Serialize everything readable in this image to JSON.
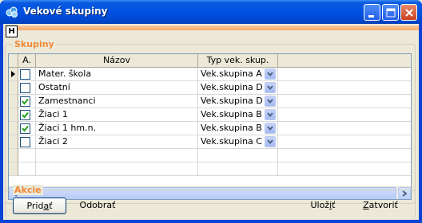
{
  "window": {
    "title": "Vekové skupiny",
    "menu_hotkey": "H"
  },
  "colors": {
    "titlebar": "#0052e2",
    "group_label": "#f08838",
    "face": "#ece9d8",
    "check": "#21a121"
  },
  "groups": {
    "skupiny": "Skupiny",
    "akcie": "Akcie"
  },
  "grid": {
    "headers": [
      "A.",
      "Názov",
      "Typ vek. skup."
    ],
    "rows": [
      {
        "active": false,
        "name": "Mater. škola",
        "type": "Vek.skupina A",
        "current": true
      },
      {
        "active": false,
        "name": "Ostatní",
        "type": "Vek.skupina D",
        "current": false
      },
      {
        "active": true,
        "name": "Zamestnanci",
        "type": "Vek.skupina D",
        "current": false
      },
      {
        "active": true,
        "name": "Žiaci 1",
        "type": "Vek.skupina B",
        "current": false
      },
      {
        "active": true,
        "name": "Žiaci 1 hm.n.",
        "type": "Vek.skupina B",
        "current": false
      },
      {
        "active": false,
        "name": "Žiaci 2",
        "type": "Vek.skupina C",
        "current": false
      }
    ]
  },
  "buttons": {
    "add_pre": "Prid",
    "add_hot": "a",
    "add_post": "ť",
    "remove": "Odobrať",
    "save_pre": "Ulož",
    "save_hot": "i",
    "save_post": "ť",
    "close_pre": "",
    "close_hot": "Z",
    "close_post": "atvoriť"
  }
}
